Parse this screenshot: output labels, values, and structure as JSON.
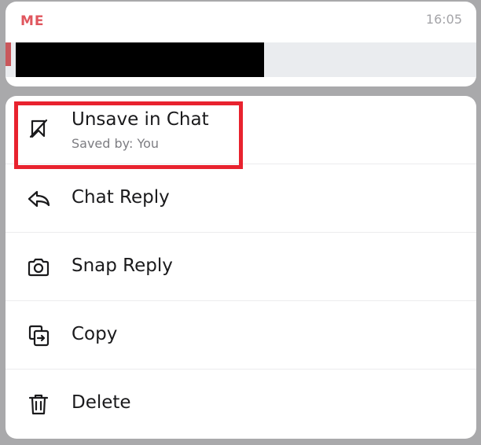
{
  "message": {
    "sender": "ME",
    "time": "16:05"
  },
  "menu": {
    "items": [
      {
        "label": "Unsave in Chat",
        "sublabel": "Saved by: You",
        "icon": "unsave-icon"
      },
      {
        "label": "Chat Reply",
        "icon": "reply-arrow-icon"
      },
      {
        "label": "Snap Reply",
        "icon": "camera-icon"
      },
      {
        "label": "Copy",
        "icon": "copy-icon"
      },
      {
        "label": "Delete",
        "icon": "trash-icon"
      }
    ]
  },
  "colors": {
    "sender": "#e0565e",
    "highlight": "#e8222e",
    "overlay": "#a9a9ab"
  }
}
